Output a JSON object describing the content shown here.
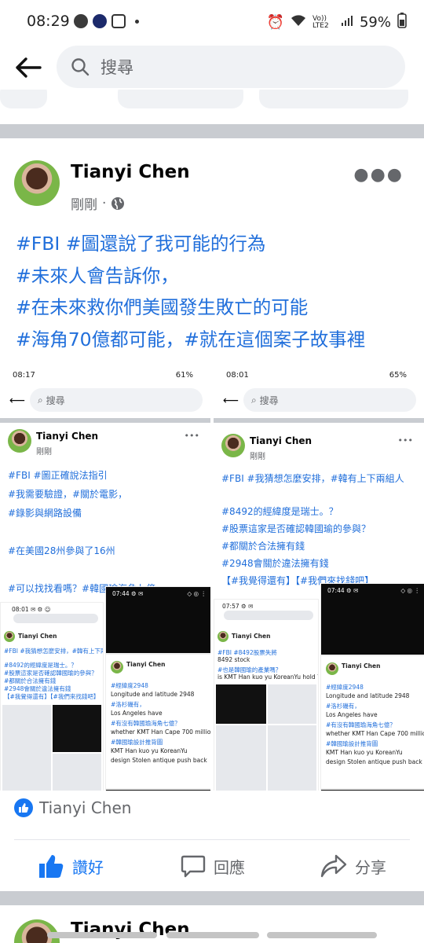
{
  "status_bar": {
    "time": "08:29",
    "battery": "59%",
    "signal": "Vo)) LTE2"
  },
  "search": {
    "placeholder": "搜尋"
  },
  "post": {
    "author": "Tianyi Chen",
    "time": "剛剛",
    "lines": [
      "#FBI #圖還說了我可能的行為",
      "#未來人會告訴你，",
      "#在未來救你們美國發生敗亡的可能",
      "#海角70億都可能，#就在這個案子故事裡"
    ],
    "screenshots": [
      {
        "status_time": "08:17",
        "status_right": "61%",
        "search": "搜尋",
        "author": "Tianyi Chen",
        "time": "剛剛",
        "lines": [
          "#FBI #圖正確說法指引",
          "#我需要驗證，#關於電影，",
          "#錄影與網路設備",
          "",
          "#在美國28州參與了16州",
          "",
          "#可以找找看嗎？#韓國瑜海角七億"
        ],
        "thumb_left": {
          "author": "Tianyi Chen",
          "lines": [
            "#FBI #我猜想怎麼安排，#韓有上下兩組人",
            "#8492的經緯度是瑞士。？",
            "#股票這家是否確認韓國瑜的參與？",
            "#都關於合法擁有錢",
            "#2948會關於違法擁有錢",
            "【#我覺得還有】【#我們來找錢吧】"
          ]
        },
        "thumb_right": {
          "author": "Tianyi Chen",
          "lines": [
            "#經緯度2948",
            "Longitude and latitude  2948",
            "#洛杉磯有，",
            "Los Angeles have",
            "#有沒有韓國瑜海角七億？",
            "whether KMT Han  Cape 700 million",
            "#韓國瑜設計推背圖",
            "KMT Han kuo yu KoreanYu",
            "design Stolen antique  push back"
          ]
        }
      },
      {
        "status_time": "08:01",
        "status_right": "65%",
        "search": "搜尋",
        "author": "Tianyi Chen",
        "time": "剛剛",
        "lines": [
          "#FBI #我猜想怎麼安排，#韓有上下兩組人",
          "",
          "#8492的經緯度是瑞士。？",
          "#股票這家是否確認韓國瑜的參與？",
          "#都關於合法擁有錢",
          "#2948會關於違法擁有錢",
          "【#我覺得還有】【#我們來找錢吧】"
        ],
        "thumb_left": {
          "author": "Tianyi Chen",
          "lines": [
            "#FBI #8492股票失將",
            "8492 stock",
            "#也是韓國瑜的產業嗎？",
            "is  KMT Han kuo yu  KoreanYu hold ?"
          ]
        },
        "thumb_right": {
          "author": "Tianyi Chen",
          "lines": [
            "#經緯度2948",
            "Longitude and latitude  2948",
            "#洛杉磯有，",
            "Los Angeles have",
            "#有沒有韓國瑜海角七億？",
            "whether KMT Han  Cape 700 million",
            "#韓國瑜設計推背圖",
            "KMT Han kuo yu KoreanYu",
            "design Stolen antique  push back"
          ]
        }
      }
    ],
    "reaction_name": "Tianyi Chen",
    "actions": {
      "like": "讚好",
      "comment": "回應",
      "share": "分享"
    }
  },
  "next_post": {
    "author": "Tianyi Chen"
  },
  "colors": {
    "link": "#216fdb",
    "like": "#1877f2",
    "gray": "#65676b",
    "separator": "#c9ccd1"
  }
}
